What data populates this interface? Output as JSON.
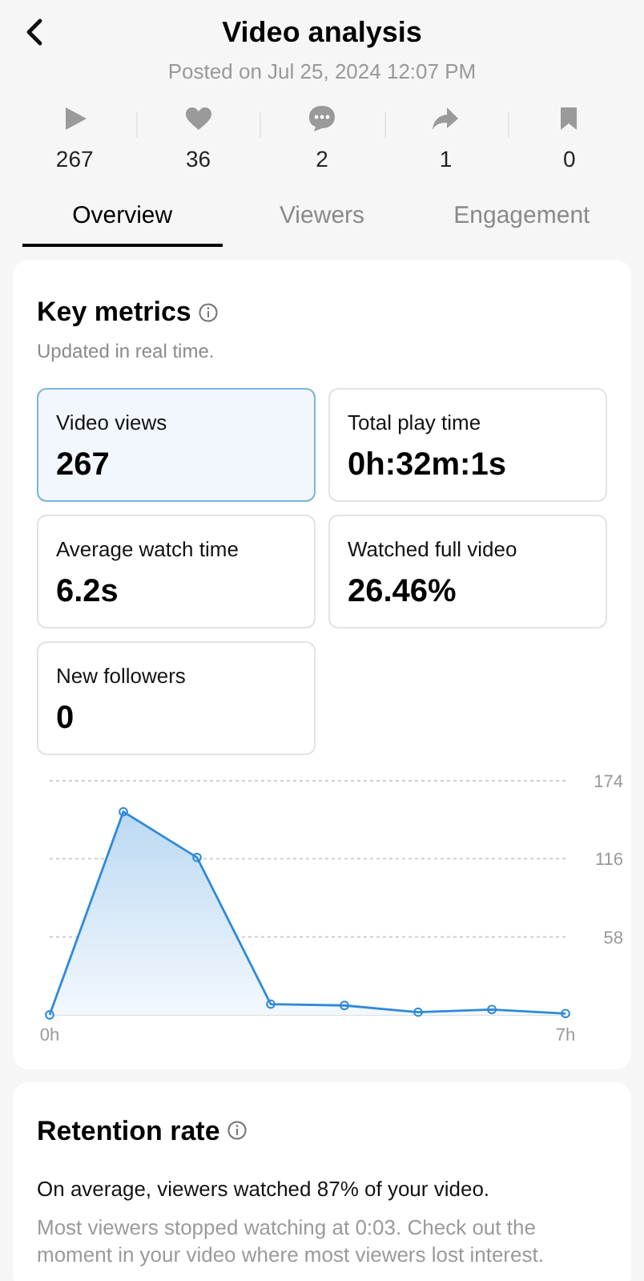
{
  "header": {
    "title": "Video analysis",
    "subtitle": "Posted on Jul 25, 2024 12:07 PM"
  },
  "stats": [
    {
      "kind": "play",
      "value": "267"
    },
    {
      "kind": "like",
      "value": "36"
    },
    {
      "kind": "comment",
      "value": "2"
    },
    {
      "kind": "share",
      "value": "1"
    },
    {
      "kind": "save",
      "value": "0"
    }
  ],
  "tabs": [
    {
      "label": "Overview",
      "selected": true
    },
    {
      "label": "Viewers",
      "selected": false
    },
    {
      "label": "Engagement",
      "selected": false
    }
  ],
  "key_metrics": {
    "title": "Key metrics",
    "subtitle": "Updated in real time.",
    "metrics": [
      {
        "label": "Video views",
        "value": "267",
        "selected": true
      },
      {
        "label": "Total play time",
        "value": "0h:32m:1s",
        "selected": false
      },
      {
        "label": "Average watch time",
        "value": "6.2s",
        "selected": false
      },
      {
        "label": "Watched full video",
        "value": "26.46%",
        "selected": false
      },
      {
        "label": "New followers",
        "value": "0",
        "selected": false
      }
    ],
    "chart_data": {
      "type": "area",
      "x": [
        0,
        1,
        2,
        3,
        4,
        5,
        6,
        7
      ],
      "series": [
        {
          "color": "#2f8ad8",
          "values": [
            0,
            151,
            117,
            8,
            7,
            2,
            4,
            1
          ]
        }
      ],
      "xlim": [
        0,
        7
      ],
      "ylim": [
        0,
        174
      ],
      "xticks": [
        {
          "value": 0,
          "label": "0h"
        },
        {
          "value": 7,
          "label": "7h"
        }
      ],
      "yticks": [
        58,
        116,
        174
      ]
    }
  },
  "retention": {
    "title": "Retention rate",
    "summary": "On average, viewers watched 87% of your video.",
    "detail": "Most viewers stopped watching at 0:03. Check out the moment in your video where most viewers lost interest."
  }
}
